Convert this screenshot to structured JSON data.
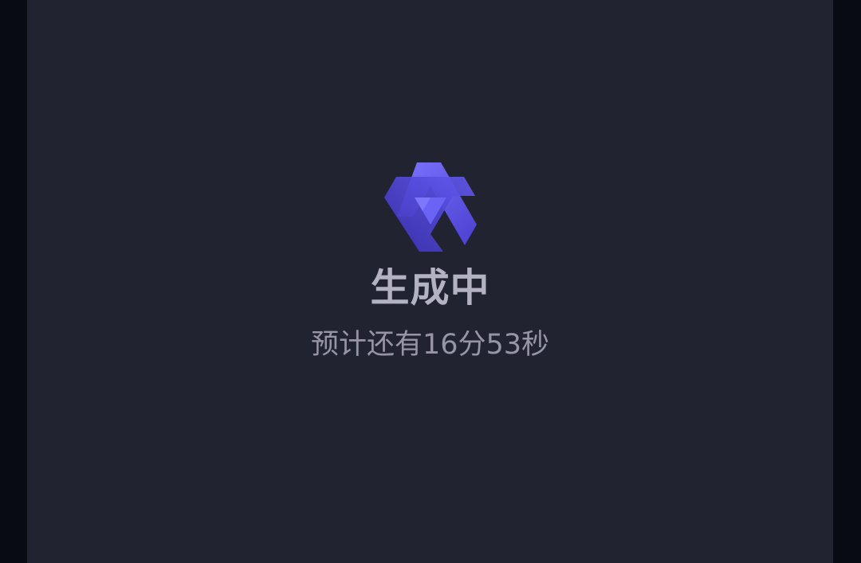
{
  "status": {
    "title": "生成中",
    "eta_text": "预计还有16分53秒"
  },
  "logo": {
    "icon": "star-hexagram-logo-icon",
    "color_light": "#6a63f4",
    "color_dark": "#4a3fcf"
  },
  "colors": {
    "page_background": "#080b12",
    "panel_background": "#212430",
    "title_text": "#b3b2c2",
    "subtitle_text": "#9694a6"
  }
}
